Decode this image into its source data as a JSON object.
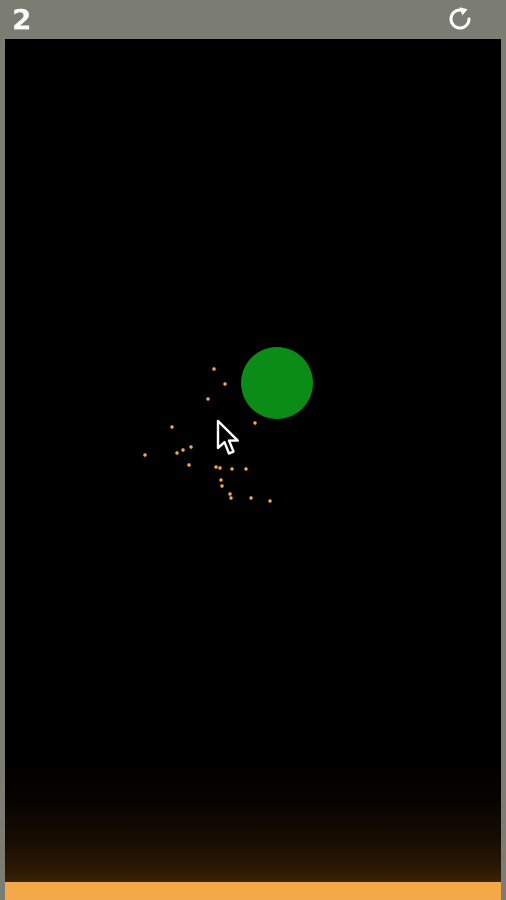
{
  "header": {
    "score": "2",
    "restart_icon": "restart-icon"
  },
  "game": {
    "ball_color": "#0a8c17",
    "particle_color": "#f3a84a",
    "ground_color": "#f3a84a",
    "background_color": "#000000",
    "frame_color": "#7b7d72",
    "cursor_icon": "mouse-pointer-icon"
  }
}
